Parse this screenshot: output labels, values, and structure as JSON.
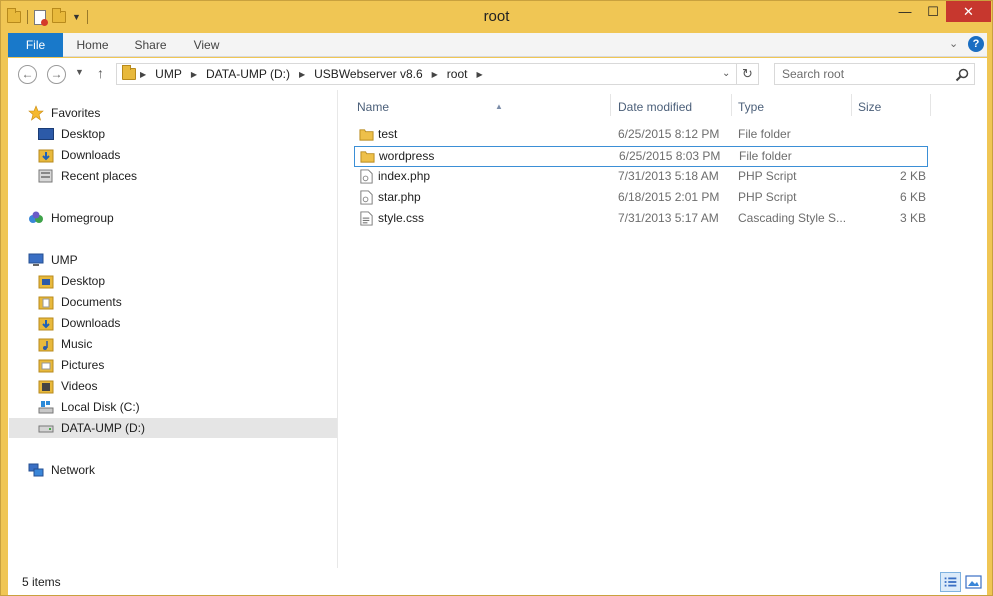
{
  "window": {
    "title": "root"
  },
  "title_buttons": {
    "minimize": "—",
    "maximize": "☐",
    "close": "✕"
  },
  "ribbon": {
    "tabs": [
      {
        "label": "File"
      },
      {
        "label": "Home"
      },
      {
        "label": "Share"
      },
      {
        "label": "View"
      }
    ]
  },
  "address": {
    "crumbs": [
      {
        "label": "UMP"
      },
      {
        "label": "DATA-UMP (D:)"
      },
      {
        "label": "USBWebserver v8.6"
      },
      {
        "label": "root"
      }
    ]
  },
  "search": {
    "placeholder": "Search root"
  },
  "nav_pane": {
    "favorites": {
      "label": "Favorites",
      "items": [
        {
          "label": "Desktop"
        },
        {
          "label": "Downloads"
        },
        {
          "label": "Recent places"
        }
      ]
    },
    "homegroup": {
      "label": "Homegroup"
    },
    "computer": {
      "label": "UMP",
      "items": [
        {
          "label": "Desktop"
        },
        {
          "label": "Documents"
        },
        {
          "label": "Downloads"
        },
        {
          "label": "Music"
        },
        {
          "label": "Pictures"
        },
        {
          "label": "Videos"
        },
        {
          "label": "Local Disk (C:)"
        },
        {
          "label": "DATA-UMP (D:)"
        }
      ]
    },
    "network": {
      "label": "Network"
    }
  },
  "columns": {
    "name": "Name",
    "date": "Date modified",
    "type": "Type",
    "size": "Size"
  },
  "files": [
    {
      "name": "test",
      "date": "6/25/2015 8:12 PM",
      "type": "File folder",
      "size": "",
      "icon": "folder-icon"
    },
    {
      "name": "wordpress",
      "date": "6/25/2015 8:03 PM",
      "type": "File folder",
      "size": "",
      "icon": "folder-icon",
      "selected": true
    },
    {
      "name": "index.php",
      "date": "7/31/2013 5:18 AM",
      "type": "PHP Script",
      "size": "2 KB",
      "icon": "php-file-icon"
    },
    {
      "name": "star.php",
      "date": "6/18/2015 2:01 PM",
      "type": "PHP Script",
      "size": "6 KB",
      "icon": "php-file-icon"
    },
    {
      "name": "style.css",
      "date": "7/31/2013 5:17 AM",
      "type": "Cascading Style S...",
      "size": "3 KB",
      "icon": "css-file-icon"
    }
  ],
  "status": {
    "item_count": "5 items"
  },
  "colors": {
    "title_bar": "#f0c654",
    "file_tab": "#1979ca",
    "close_button": "#c7372e",
    "selection_border": "#3b8fd6"
  }
}
